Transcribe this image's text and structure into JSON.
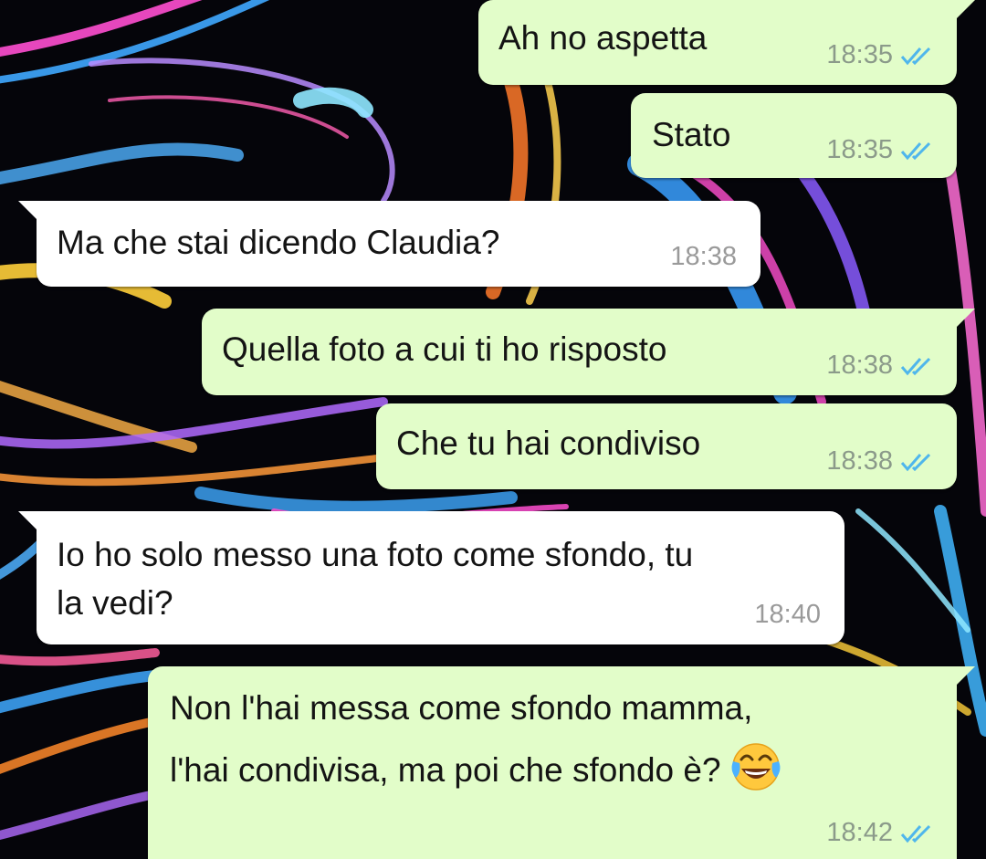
{
  "chat": {
    "messages": [
      {
        "text": "Ah no aspetta",
        "time": "18:35",
        "read_icon": "double-check-icon",
        "direction": "outgoing"
      },
      {
        "text": "Stato",
        "time": "18:35",
        "read_icon": "double-check-icon",
        "direction": "outgoing"
      },
      {
        "text": "Ma che stai dicendo Claudia?",
        "time": "18:38",
        "direction": "incoming"
      },
      {
        "text": "Quella foto a cui ti ho risposto",
        "time": "18:38",
        "read_icon": "double-check-icon",
        "direction": "outgoing"
      },
      {
        "text": "Che tu hai condiviso",
        "time": "18:38",
        "read_icon": "double-check-icon",
        "direction": "outgoing"
      },
      {
        "line1": "Io ho solo messo una foto come sfondo, tu",
        "line2": "la vedi?",
        "time": "18:40",
        "direction": "incoming"
      },
      {
        "line1": "Non l'hai messa come sfondo mamma,",
        "line2": "l'hai condivisa, ma poi che sfondo è?",
        "emoji": "face-with-tears-of-joy-icon",
        "time": "18:42",
        "read_icon": "double-check-icon",
        "direction": "outgoing"
      }
    ]
  },
  "colors": {
    "outgoing_bubble": "#e2fdc9",
    "incoming_bubble": "#ffffff",
    "read_ticks": "#4fb6ec",
    "wallpaper_base": "#05050a"
  }
}
